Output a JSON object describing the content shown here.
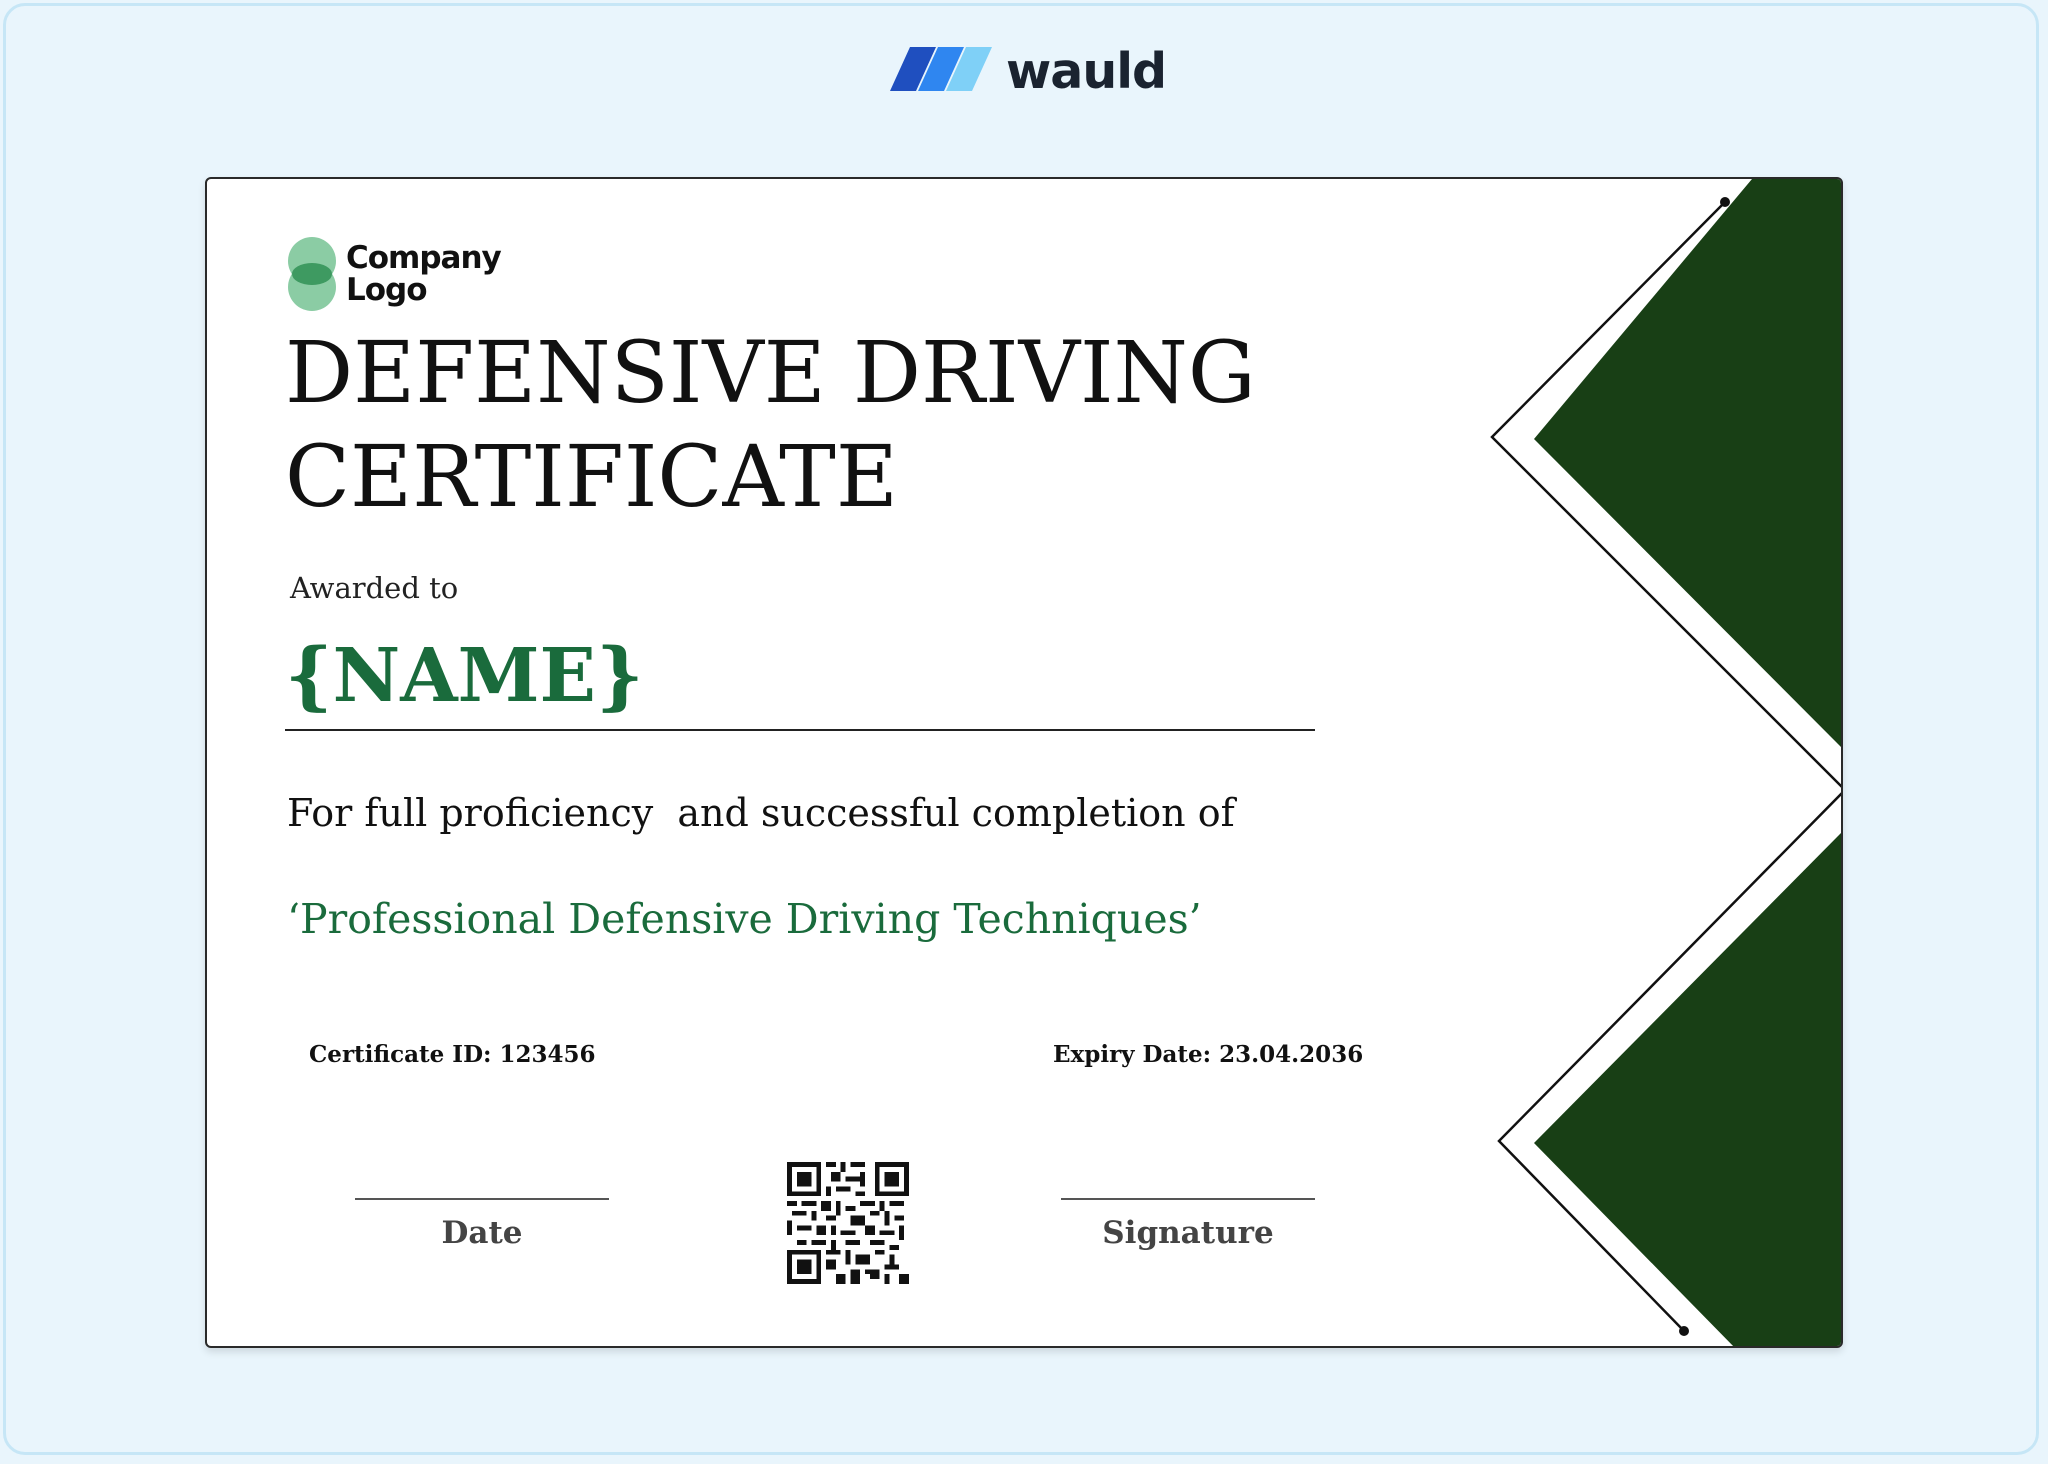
{
  "brand": {
    "name": "wauld",
    "icon": "wauld-logo-icon",
    "colors": {
      "dark": "#1f4fbf",
      "mid": "#2f86f0",
      "light": "#7fd0f7"
    }
  },
  "certificate": {
    "company_logo": {
      "line1": "Company",
      "line2": "Logo",
      "icon": "company-logo-icon"
    },
    "title_line1": "DEFENSIVE DRIVING",
    "title_line2": "CERTIFICATE",
    "awarded_to": "Awarded to",
    "name": "{NAME}",
    "description": "For full proficiency  and successful completion of",
    "course": "‘Professional Defensive Driving Techniques’",
    "certificate_id": "Certificate ID: 123456",
    "expiry_date": "Expiry Date: 23.04.2036",
    "date_label": "Date",
    "signature_label": "Signature",
    "qr_icon": "qr-code-icon"
  },
  "colors": {
    "page_background": "#e9f5fc",
    "accent_green": "#1a6b3c",
    "decoration_green": "#183f15",
    "logo_green": "#7ec69a"
  }
}
